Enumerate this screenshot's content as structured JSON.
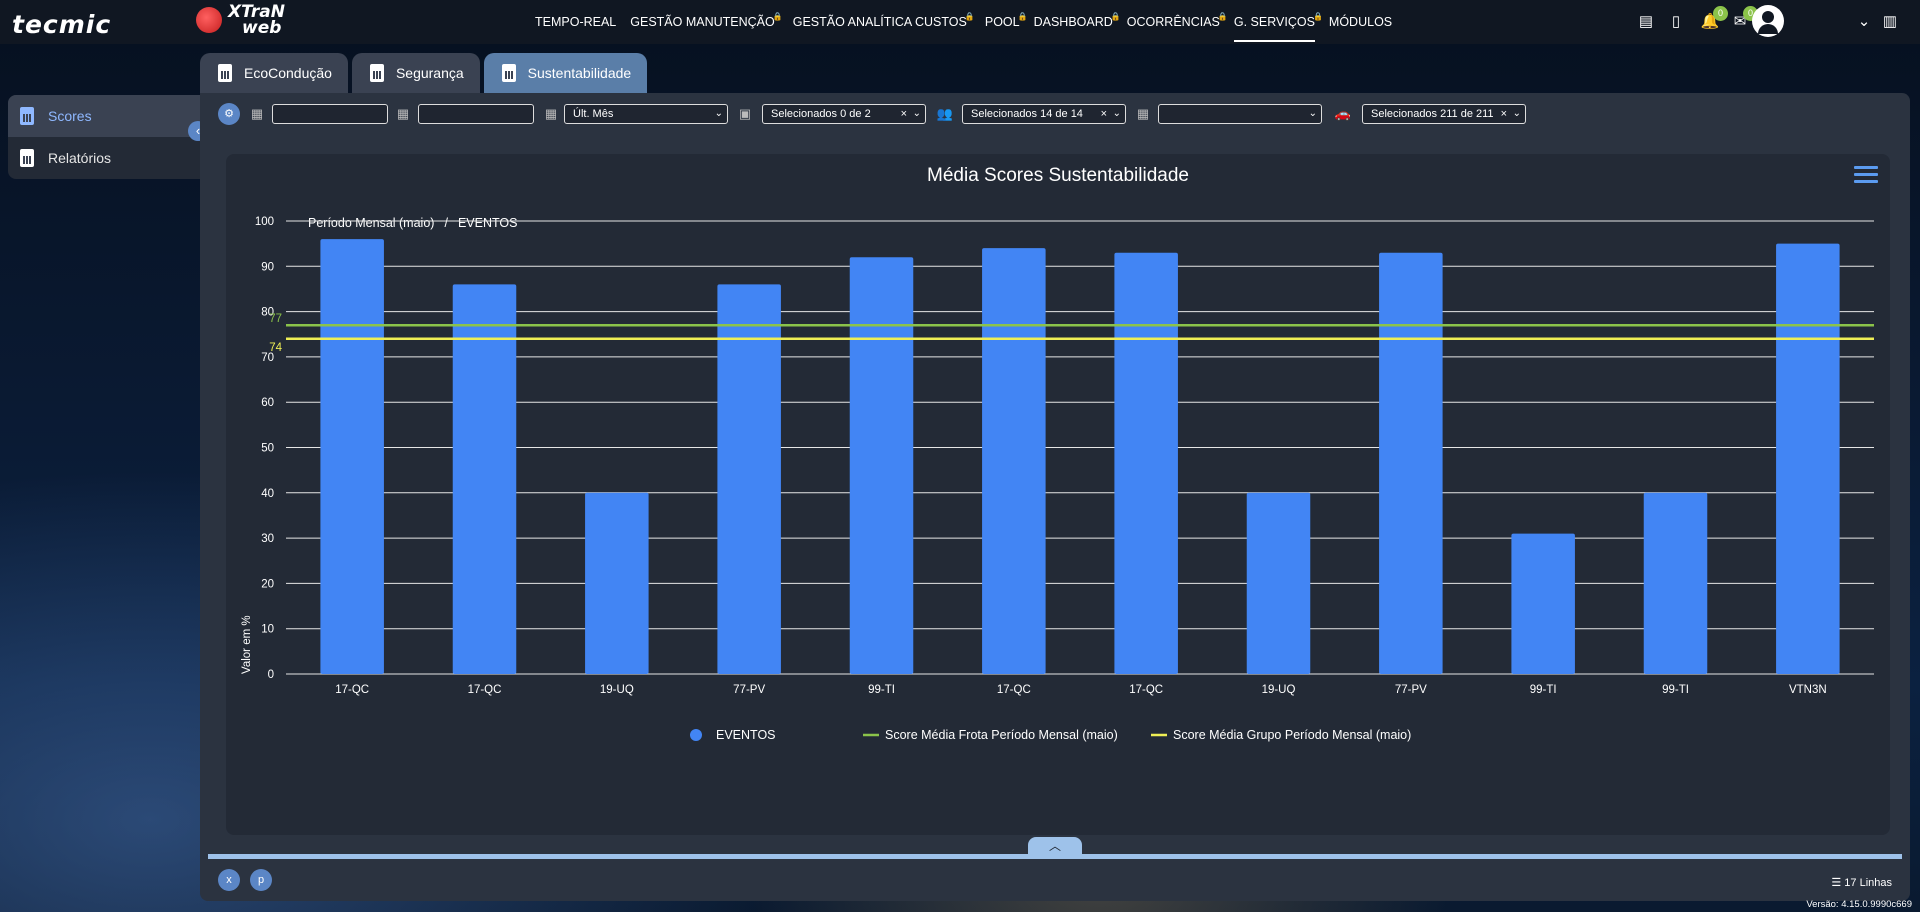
{
  "header": {
    "logo_tecmic": "tecmic",
    "logo_xtran_line1": "XTraN",
    "logo_xtran_line2": "web",
    "nav": [
      {
        "label": "TEMPO-REAL",
        "locked": false,
        "active": false
      },
      {
        "label": "GESTÃO MANUTENÇÃO",
        "locked": true,
        "active": false
      },
      {
        "label": "GESTÃO ANALÍTICA CUSTOS",
        "locked": true,
        "active": false
      },
      {
        "label": "POOL",
        "locked": true,
        "active": false
      },
      {
        "label": "DASHBOARD",
        "locked": true,
        "active": false
      },
      {
        "label": "OCORRÊNCIAS",
        "locked": true,
        "active": false
      },
      {
        "label": "G. SERVIÇOS",
        "locked": true,
        "active": true
      },
      {
        "label": "MÓDULOS",
        "locked": false,
        "active": false
      }
    ],
    "notifications_count": "0",
    "messages_count": "0"
  },
  "tabs": [
    {
      "label": "EcoCondução",
      "active": false
    },
    {
      "label": "Segurança",
      "active": false
    },
    {
      "label": "Sustentabilidade",
      "active": true
    }
  ],
  "sidebar": {
    "items": [
      {
        "label": "Scores",
        "active": true
      },
      {
        "label": "Relatórios",
        "active": false
      }
    ]
  },
  "filters": {
    "date_from": "",
    "date_to": "",
    "period": "Últ. Mês",
    "clients": "Selecionados 0 de 2",
    "groups": "Selecionados 14 de 14",
    "category": "",
    "vehicles": "Selecionados 211 de 211"
  },
  "chart_data": {
    "type": "bar",
    "title": "Média Scores Sustentabilidade",
    "breadcrumb": [
      "Período Mensal (maio)",
      "EVENTOS"
    ],
    "ylabel": "Valor em %",
    "ylim": [
      0,
      100
    ],
    "yticks": [
      0,
      10,
      20,
      30,
      40,
      50,
      60,
      70,
      80,
      90,
      100
    ],
    "grid": true,
    "categories": [
      "17-QC",
      "17-QC",
      "19-UQ",
      "77-PV",
      "99-TI",
      "17-QC",
      "17-QC",
      "19-UQ",
      "77-PV",
      "99-TI",
      "99-TI",
      "VTN3N"
    ],
    "series": [
      {
        "name": "EVENTOS",
        "color": "#4285f4",
        "values": [
          96,
          86,
          40,
          86,
          92,
          94,
          93,
          40,
          93,
          31,
          40,
          95
        ]
      }
    ],
    "reference_lines": [
      {
        "name": "Score Média Frota Período Mensal (maio)",
        "value": 77,
        "label": "77",
        "color": "#8bc34a"
      },
      {
        "name": "Score Média Grupo Período Mensal (maio)",
        "value": 74,
        "label": "74",
        "color": "#eeee55"
      }
    ],
    "legend_position": "bottom"
  },
  "footer": {
    "lines": "17 Linhas",
    "version": "Versão: 4.15.0.9990c669"
  },
  "colors": {
    "accent": "#5b86c6",
    "bar": "#4285f4",
    "fleet_line": "#8bc34a",
    "group_line": "#eeee55"
  }
}
